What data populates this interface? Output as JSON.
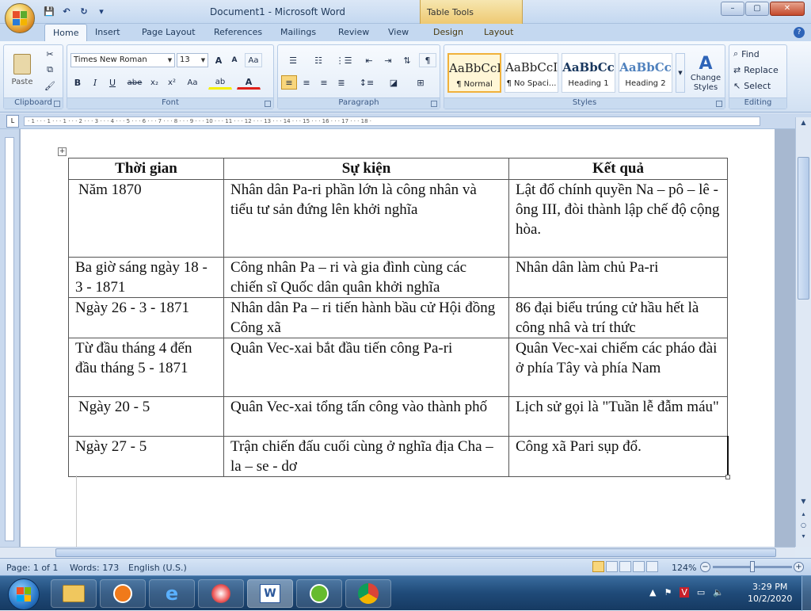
{
  "window": {
    "title": "Document1 - Microsoft Word",
    "context_tab_group": "Table Tools",
    "controls": {
      "minimize": "–",
      "maximize": "▢",
      "close": "✕"
    }
  },
  "qat": {
    "save": "💾",
    "undo": "↶",
    "redo": "↻",
    "customize": "▾"
  },
  "tabs": [
    "Home",
    "Insert",
    "Page Layout",
    "References",
    "Mailings",
    "Review",
    "View",
    "Design",
    "Layout"
  ],
  "ribbon": {
    "clipboard": {
      "label": "Clipboard",
      "paste": "Paste"
    },
    "font": {
      "label": "Font",
      "font_name": "Times New Roman",
      "font_size": "13",
      "grow": "A",
      "shrink": "A",
      "clear": "Aa",
      "bold": "B",
      "italic": "I",
      "underline": "U",
      "strike": "abe",
      "subscript": "x₂",
      "superscript": "x²",
      "change_case": "Aa",
      "highlight": "ab",
      "font_color": "A"
    },
    "paragraph": {
      "label": "Paragraph"
    },
    "styles": {
      "label": "Styles",
      "items": [
        {
          "preview": "AaBbCcI",
          "name": "¶ Normal",
          "color": "#222222"
        },
        {
          "preview": "AaBbCcI",
          "name": "¶ No Spaci...",
          "color": "#222222"
        },
        {
          "preview": "AaBbCc",
          "name": "Heading 1",
          "color": "#17365d"
        },
        {
          "preview": "AaBbCc",
          "name": "Heading 2",
          "color": "#4f81bd"
        }
      ],
      "change_styles": "Change Styles"
    },
    "editing": {
      "label": "Editing",
      "find": "Find",
      "replace": "Replace",
      "select": "Select"
    }
  },
  "ruler": {
    "marks": "· 1 · · · 1 · · · 1 · · · 2 · · · 3 · · · 4 · · · 5 · · · 6 · · · 7 · · · 8 · · · 9 · · · 10 · · · 11 · · · 12 · · · 13 · · · 14 · · · 15 · · · 16 · · · 17 · · · 18 ·"
  },
  "document": {
    "table": {
      "headers": [
        "Thời gian",
        "Sự kiện",
        "Kết quả"
      ],
      "rows": [
        [
          "Năm 1870",
          "Nhân dân Pa-ri phần lớn là công nhân và tiểu tư sản đứng lên khởi nghĩa",
          "Lật đổ chính quyền Na – pô – lê - ông III, đòi thành lập chế độ cộng hòa."
        ],
        [
          "Ba giờ sáng ngày 18 - 3 - 1871",
          "Công nhân Pa – ri và gia đình cùng các chiến sĩ Quốc dân quân khởi nghĩa",
          "Nhân dân làm chủ Pa-ri"
        ],
        [
          "Ngày 26 - 3 - 1871",
          "Nhân dân Pa – ri tiến hành bầu cử Hội đồng Công xã",
          "86 đại biểu trúng cử hầu hết là công nhâ và trí thức"
        ],
        [
          "Từ đầu tháng 4 đến đầu tháng 5 - 1871",
          "Quân Vec-xai bắt đầu tiến công Pa-ri",
          "Quân Vec-xai chiếm các pháo đài ở phía Tây và phía Nam"
        ],
        [
          "Ngày 20 - 5",
          "Quân Vec-xai tổng tấn công vào thành phố",
          "Lịch sử gọi là \"Tuần lễ đẫm máu\""
        ],
        [
          "Ngày 27 - 5",
          "Trận chiến đấu cuối cùng ở nghĩa địa Cha – la – se - dơ",
          "Công xã Pari sụp đổ."
        ]
      ]
    }
  },
  "status": {
    "page": "Page: 1 of 1",
    "words": "Words: 173",
    "language": "English (U.S.)",
    "zoom": "124%"
  },
  "taskbar": {
    "time": "3:29 PM",
    "date": "10/2/2020"
  },
  "colors": {
    "ribbon_bg": "#dce8f6",
    "context_tab": "#eec972",
    "taskbar": "#1f4a78"
  }
}
